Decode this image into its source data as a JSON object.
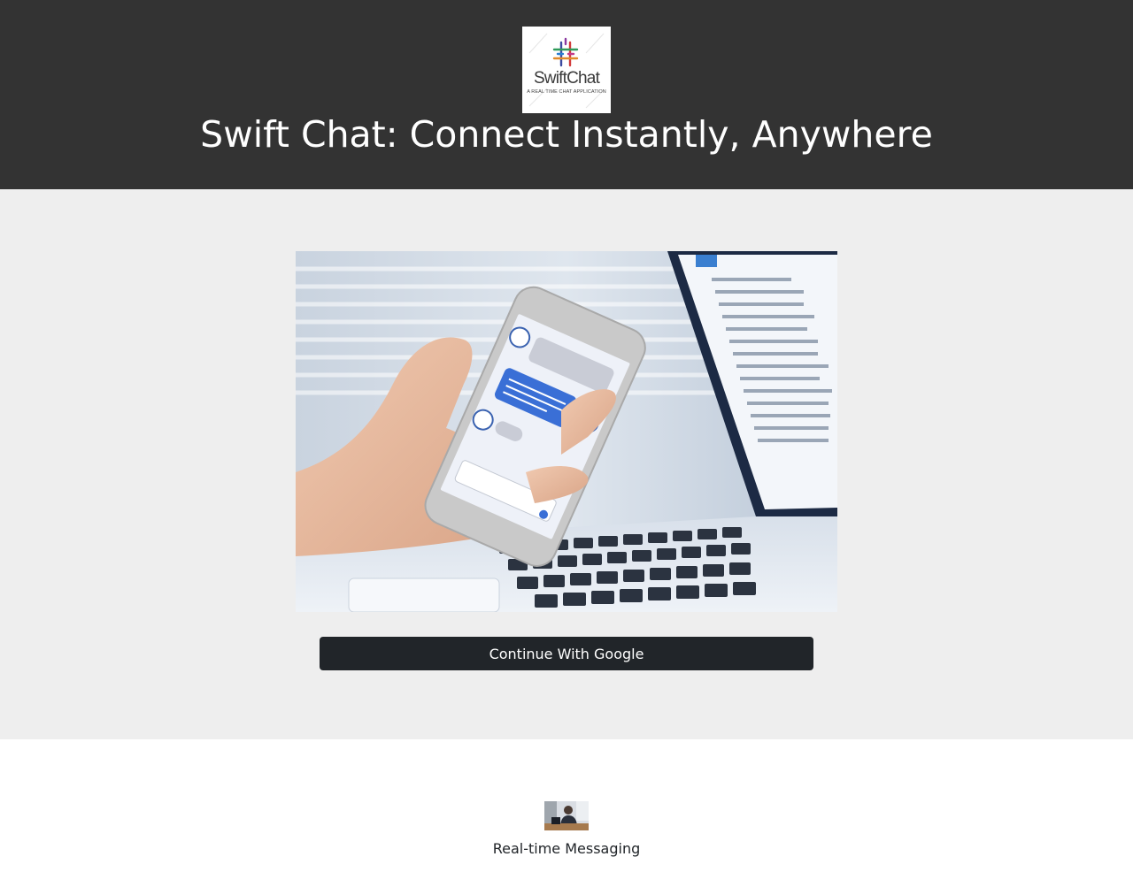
{
  "header": {
    "logo": {
      "name": "SwiftChat",
      "tagline": "A REAL TIME CHAT APPLICATION"
    },
    "title": "Swift Chat: Connect Instantly, Anywhere"
  },
  "hero": {
    "image_icon": "phone-chat-over-laptop-photo",
    "login_button": "Continue With Google"
  },
  "features": [
    {
      "icon": "person-at-desk-photo",
      "label": "Real-time Messaging"
    }
  ],
  "colors": {
    "header_bg": "#333333",
    "hero_bg": "#eeeeee",
    "button_bg": "#212529",
    "text_dark": "#212529"
  }
}
